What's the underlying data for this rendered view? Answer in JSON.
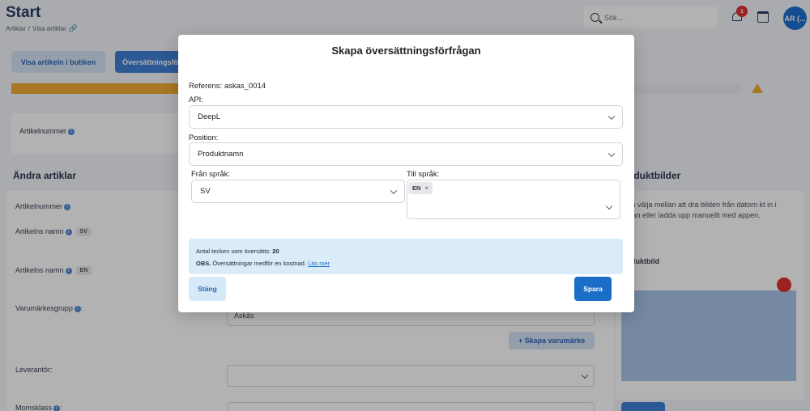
{
  "header": {
    "title": "Start",
    "breadcrumb": [
      "Artiklar",
      "/",
      "Visa artiklar"
    ],
    "search_placeholder": "Sök...",
    "notification_count": "1",
    "avatar_initials": "AR (..."
  },
  "toolbar": {
    "view_in_store": "Visa artikeln i butiken",
    "translation_tab": "Översättningsfö"
  },
  "article": {
    "number_label": "Artikelnummer"
  },
  "edit": {
    "section_title": "Ändra artiklar",
    "article_number_label": "Artikelnummer",
    "article_name_label": "Artikelns namn",
    "lang_sv": "SV",
    "lang_en": "EN",
    "brand_group_label": "Varumärkesgrupp",
    "brand_group_colon": ":",
    "brand_value": "Askås",
    "create_brand_button": "+ Skapa varumärke",
    "supplier_label": "Leverantör:",
    "vat_label": "Momsklass",
    "vat_colon": ":"
  },
  "product_images": {
    "title": "oduktbilder",
    "description": "kan välja mellan att dra bilden från datorn kt in i rutan eller ladda upp manuellt med appen.",
    "image_label": "duktbild"
  },
  "modal": {
    "title": "Skapa översättningsförfrågan",
    "reference": "Referens: askas_0014",
    "api_label": "API:",
    "api_value": "DeepL",
    "position_label": "Position:",
    "position_value": "Produktnamn",
    "from_label": "Från språk:",
    "from_value": "SV",
    "to_label": "Till språk:",
    "to_tag": "EN",
    "to_tag_remove": "×",
    "info_count_label": "Antal tecken som översätts:",
    "info_count_value": "20",
    "info_note_bold": "OBS.",
    "info_note_text": "Översättningar medför en kostnad.",
    "info_link": "Läs mer",
    "close_button": "Stäng",
    "save_button": "Spara"
  }
}
